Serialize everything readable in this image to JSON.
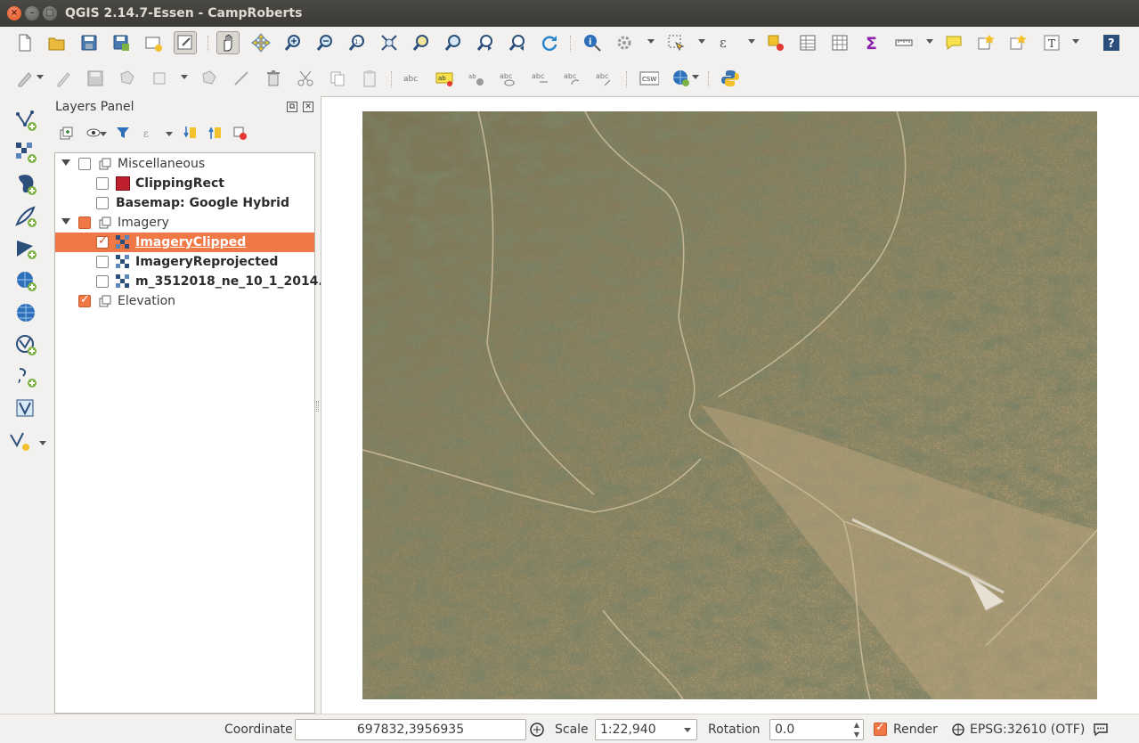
{
  "window": {
    "title": "QGIS 2.14.7-Essen - CampRoberts",
    "close_glyph": "×",
    "min_glyph": "–",
    "max_glyph": "□"
  },
  "toolbar_top": {
    "icons": [
      "new-project-icon",
      "open-project-icon",
      "save-project-icon",
      "save-as-icon",
      "new-print-composer-icon",
      "composer-manager-icon",
      "pan-icon",
      "pan-to-selection-icon",
      "zoom-in-icon",
      "zoom-out-icon",
      "zoom-actual-size-icon",
      "zoom-full-icon",
      "zoom-to-selection-icon",
      "zoom-to-layer-icon",
      "zoom-last-icon",
      "zoom-next-icon",
      "refresh-icon",
      "identify-icon",
      "run-action-icon",
      "select-features-icon",
      "select-by-expression-icon",
      "deselect-icon",
      "attribute-table-icon",
      "field-calculator-icon",
      "statistics-icon",
      "measure-icon",
      "map-tips-icon",
      "text-annotation-icon",
      "form-annotation-icon",
      "label-icon",
      "help-icon"
    ]
  },
  "toolbar_bottom": {
    "csw_label": "CSW",
    "abc_label": "abc"
  },
  "layers_panel": {
    "title": "Layers Panel",
    "float_glyph": "⧉",
    "close_glyph": "✕",
    "layers": [
      {
        "name": "Miscellaneous",
        "type": "group",
        "checked": "unchecked",
        "level": 0
      },
      {
        "name": "ClippingRect",
        "type": "vector",
        "checked": "unchecked",
        "level": 1,
        "color": "#c0202e"
      },
      {
        "name": "Basemap: Google Hybrid",
        "type": "plain",
        "checked": "unchecked",
        "level": 1
      },
      {
        "name": "Imagery",
        "type": "group",
        "checked": "partial",
        "level": 0
      },
      {
        "name": "ImageryClipped",
        "type": "raster",
        "checked": "checked",
        "level": 1,
        "selected": true
      },
      {
        "name": "ImageryReprojected",
        "type": "raster",
        "checked": "unchecked",
        "level": 1
      },
      {
        "name": "m_3512018_ne_10_1_2014...",
        "type": "raster",
        "checked": "unchecked",
        "level": 1
      },
      {
        "name": "Elevation",
        "type": "group",
        "checked": "checked",
        "level": 0
      }
    ]
  },
  "statusbar": {
    "coordinate_label": "Coordinate",
    "coordinate_value": "697832,3956935",
    "scale_label": "Scale",
    "scale_value": "1:22,940",
    "rotation_label": "Rotation",
    "rotation_value": "0.0",
    "spin_up": "▲",
    "spin_down": "▼",
    "render_label": "Render",
    "crs_label": "EPSG:32610 (OTF)"
  },
  "colors": {
    "accent": "#f07746",
    "selection": "#f07746",
    "titlebar": "#3c3b37",
    "canvas_bg": "#ffffff",
    "terrain": "#8f7f58"
  }
}
